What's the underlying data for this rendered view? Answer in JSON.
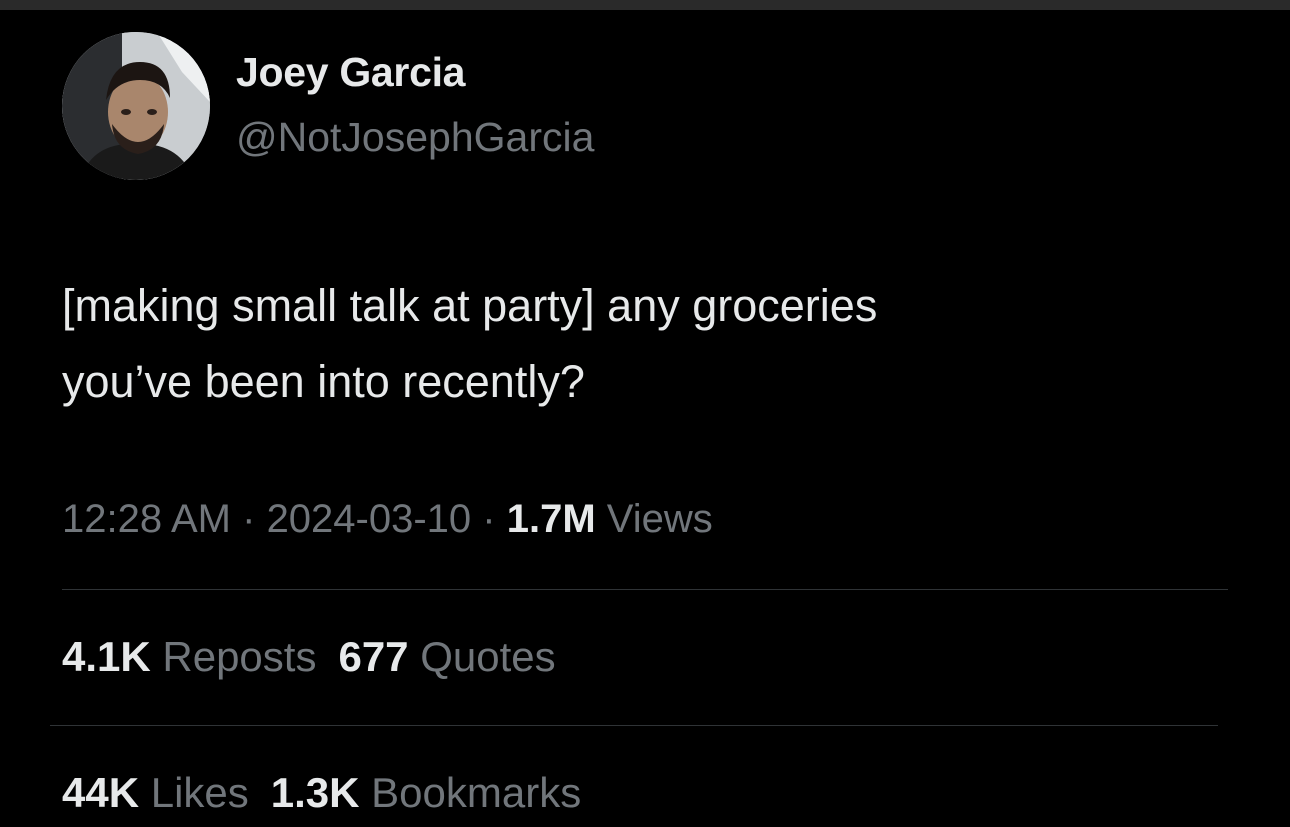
{
  "tweet": {
    "author": {
      "display_name": "Joey Garcia",
      "handle": "@NotJosephGarcia"
    },
    "text_lines": [
      "[making small talk at party] any groceries",
      "you’ve been into recently?"
    ],
    "meta": {
      "time": "12:28 AM",
      "separator": " · ",
      "date": "2024-03-10",
      "views_count": "1.7M",
      "views_label": " Views"
    },
    "stats": {
      "reposts": {
        "count": "4.1K",
        "label": " Reposts"
      },
      "quotes": {
        "count": "677",
        "label": " Quotes"
      },
      "likes": {
        "count": "44K",
        "label": " Likes"
      },
      "bookmarks": {
        "count": "1.3K",
        "label": " Bookmarks"
      }
    }
  },
  "colors": {
    "background": "#000000",
    "primary_text": "#e7e9ea",
    "secondary_text": "#71767b",
    "divider": "#2f3336"
  },
  "icons": {
    "avatar": "profile-photo"
  }
}
